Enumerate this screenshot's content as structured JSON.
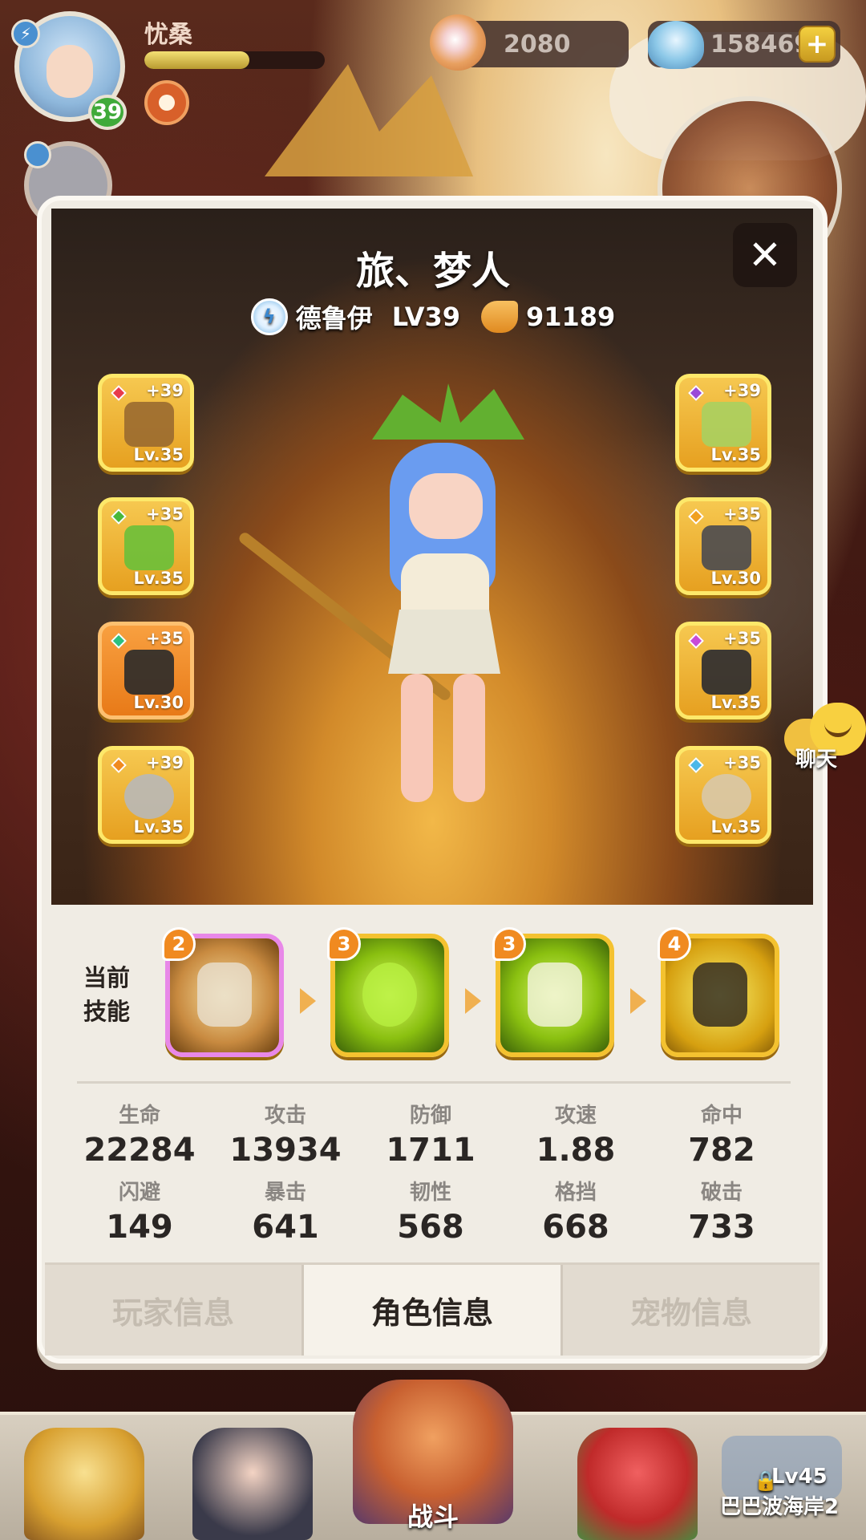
{
  "hud": {
    "player_name": "忧桑",
    "player_level": "39",
    "exp_fraction": 0.58,
    "currency1_value": "2080",
    "currency2_value": "158469",
    "plus_label": "+"
  },
  "character": {
    "title": "旅、梦人",
    "class_name": "德鲁伊",
    "level_label": "LV39",
    "power": "91189",
    "close_label": "✕"
  },
  "equipment_left": [
    {
      "plus": "+39",
      "lv": "Lv.35",
      "gem_color": "#e83a4a"
    },
    {
      "plus": "+35",
      "lv": "Lv.35",
      "gem_color": "#4ab83a"
    },
    {
      "plus": "+35",
      "lv": "Lv.30",
      "gem_color": "#2ac080"
    },
    {
      "plus": "+39",
      "lv": "Lv.35",
      "gem_color": "#f08a20"
    }
  ],
  "equipment_right": [
    {
      "plus": "+39",
      "lv": "Lv.35",
      "gem_color": "#9a4ad8"
    },
    {
      "plus": "+35",
      "lv": "Lv.30",
      "gem_color": "#f0a020"
    },
    {
      "plus": "+35",
      "lv": "Lv.35",
      "gem_color": "#c84ad8"
    },
    {
      "plus": "+35",
      "lv": "Lv.35",
      "gem_color": "#4ab8e8"
    }
  ],
  "skills": {
    "label": "当前技能",
    "items": [
      {
        "num": "2"
      },
      {
        "num": "3"
      },
      {
        "num": "3"
      },
      {
        "num": "4"
      }
    ]
  },
  "stats": [
    {
      "label": "生命",
      "value": "22284"
    },
    {
      "label": "攻击",
      "value": "13934"
    },
    {
      "label": "防御",
      "value": "1711"
    },
    {
      "label": "攻速",
      "value": "1.88"
    },
    {
      "label": "命中",
      "value": "782"
    },
    {
      "label": "闪避",
      "value": "149"
    },
    {
      "label": "暴击",
      "value": "641"
    },
    {
      "label": "韧性",
      "value": "568"
    },
    {
      "label": "格挡",
      "value": "668"
    },
    {
      "label": "破击",
      "value": "733"
    }
  ],
  "tabs": [
    {
      "label": "玩家信息",
      "active": false
    },
    {
      "label": "角色信息",
      "active": true
    },
    {
      "label": "宠物信息",
      "active": false
    }
  ],
  "chat_label": "聊天",
  "bottom": {
    "battle_label": "战斗",
    "lock_level": "Lv45",
    "map_name": "巴巴波海岸2"
  }
}
